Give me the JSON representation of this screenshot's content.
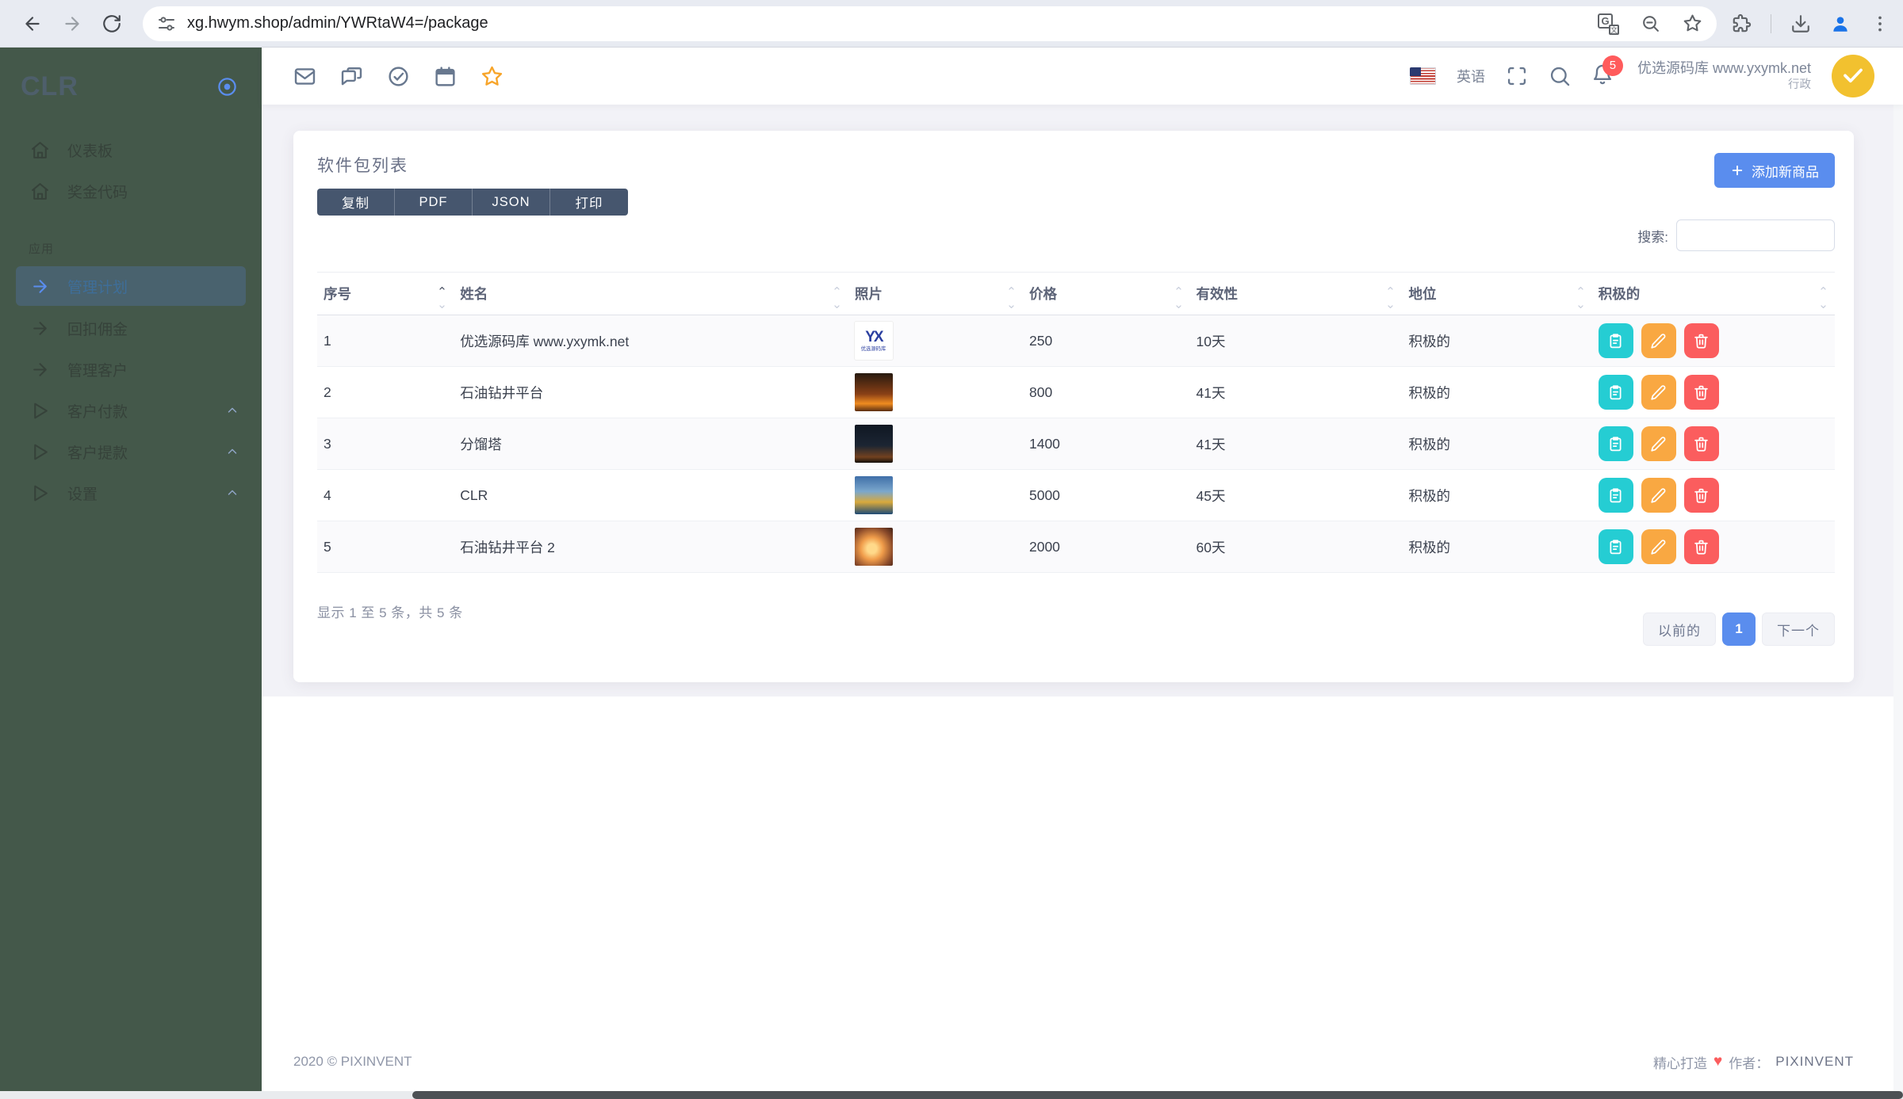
{
  "colors": {
    "primary": "#5a8dee",
    "sidebar_bg": "#44584a",
    "action_view": "#25cdd3",
    "action_edit": "#f9a842",
    "action_delete": "#fb5d5e",
    "badge": "#ff5b5c",
    "export_button": "#46566e",
    "avatar_bg": "#f2c12f"
  },
  "browser": {
    "url": "xg.hwym.shop/admin/YWRtaW4=/package"
  },
  "sidebar": {
    "logo": "CLR",
    "items": [
      {
        "label": "仪表板",
        "icon": "home-icon"
      },
      {
        "label": "奖金代码",
        "icon": "home-icon"
      }
    ],
    "section": "应用",
    "app_items": [
      {
        "label": "管理计划",
        "icon": "arrow-right-icon",
        "active": true
      },
      {
        "label": "回扣佣金",
        "icon": "arrow-right-icon"
      },
      {
        "label": "管理客户",
        "icon": "arrow-right-icon"
      },
      {
        "label": "客户付款",
        "icon": "play-icon",
        "collapsible": true
      },
      {
        "label": "客户提款",
        "icon": "play-icon",
        "collapsible": true
      },
      {
        "label": "设置",
        "icon": "play-icon",
        "collapsible": true
      }
    ]
  },
  "navbar": {
    "language": "英语",
    "notification_count": "5",
    "user_name": "优选源码库 www.yxymk.net",
    "user_role": "行政"
  },
  "card": {
    "title": "软件包列表",
    "export_buttons": [
      "复制",
      "PDF",
      "JSON",
      "打印"
    ],
    "add_button": "添加新商品",
    "search_label": "搜索:",
    "search_value": ""
  },
  "table": {
    "headers": [
      "序号",
      "姓名",
      "照片",
      "价格",
      "有效性",
      "地位",
      "积极的"
    ],
    "sorted_column": "序号",
    "rows": [
      {
        "id": "1",
        "name": "优选源码库 www.yxymk.net",
        "photo": "yxymk-logo",
        "photo_monogram": "YX",
        "photo_text": "优选源码库",
        "price": "250",
        "validity": "10天",
        "status": "积极的"
      },
      {
        "id": "2",
        "name": "石油钻井平台",
        "photo": "oil-pumpjacks-sunset",
        "price": "800",
        "validity": "41天",
        "status": "积极的"
      },
      {
        "id": "3",
        "name": "分馏塔",
        "photo": "fractionating-tower-night",
        "price": "1400",
        "validity": "41天",
        "status": "积极的"
      },
      {
        "id": "4",
        "name": "CLR",
        "photo": "offshore-platform",
        "price": "5000",
        "validity": "45天",
        "status": "积极的"
      },
      {
        "id": "5",
        "name": "石油钻井平台 2",
        "photo": "oil-pumpjack-sunset",
        "price": "2000",
        "validity": "60天",
        "status": "积极的"
      }
    ],
    "info": "显示 1 至 5 条，共 5 条"
  },
  "pagination": {
    "previous": "以前的",
    "page": "1",
    "next": "下一个"
  },
  "footer": {
    "copyright": "2020 © PIXINVENT",
    "made_with": "精心打造",
    "heart": "♥",
    "author_label": "作者：",
    "author": "PIXINVENT"
  }
}
